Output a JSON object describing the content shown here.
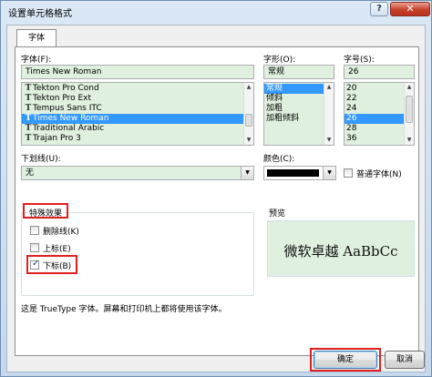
{
  "window": {
    "title": "设置单元格格式",
    "help": "?",
    "close": "✕"
  },
  "tabs": [
    {
      "label": "字体",
      "active": true
    }
  ],
  "font": {
    "label": "字体(F):",
    "value": "Times New Roman",
    "list": [
      {
        "name": "Tekton Pro Cond",
        "icon": "truetype-icon",
        "selected": false
      },
      {
        "name": "Tekton Pro Ext",
        "icon": "truetype-icon",
        "selected": false
      },
      {
        "name": "Tempus Sans ITC",
        "icon": "truetype-icon",
        "selected": false
      },
      {
        "name": "Times New Roman",
        "icon": "truetype-icon",
        "selected": true
      },
      {
        "name": "Traditional Arabic",
        "icon": "truetype-icon",
        "selected": false
      },
      {
        "name": "Trajan Pro 3",
        "icon": "truetype-icon",
        "selected": false
      }
    ]
  },
  "style": {
    "label": "字形(O):",
    "value": "常规",
    "list": [
      {
        "name": "常规",
        "selected": true
      },
      {
        "name": "倾斜",
        "selected": false
      },
      {
        "name": "加粗",
        "selected": false
      },
      {
        "name": "加粗倾斜",
        "selected": false
      }
    ]
  },
  "size": {
    "label": "字号(S):",
    "value": "26",
    "list": [
      {
        "name": "20",
        "selected": false
      },
      {
        "name": "22",
        "selected": false
      },
      {
        "name": "24",
        "selected": false
      },
      {
        "name": "26",
        "selected": true
      },
      {
        "name": "28",
        "selected": false
      },
      {
        "name": "36",
        "selected": false
      }
    ]
  },
  "underline": {
    "label": "下划线(U):",
    "value": "无"
  },
  "color": {
    "label": "颜色(C):",
    "value_hex": "#000000"
  },
  "normal_font": {
    "label": "普通字体(N)",
    "checked": false
  },
  "effects": {
    "label": "特殊效果",
    "strikethrough": {
      "label": "删除线(K)",
      "checked": false
    },
    "superscript": {
      "label": "上标(E)",
      "checked": false
    },
    "subscript": {
      "label": "下标(B)",
      "checked": true
    }
  },
  "preview": {
    "label": "预览",
    "text": "微软卓越  AaBbCc"
  },
  "info_text": "这是 TrueType 字体。屏幕和打印机上都将使用该字体。",
  "buttons": {
    "ok": "确定",
    "cancel": "取消"
  },
  "colors": {
    "highlight": "#e02020",
    "selection": "#3399ff",
    "field_bg": "#dff0df"
  }
}
